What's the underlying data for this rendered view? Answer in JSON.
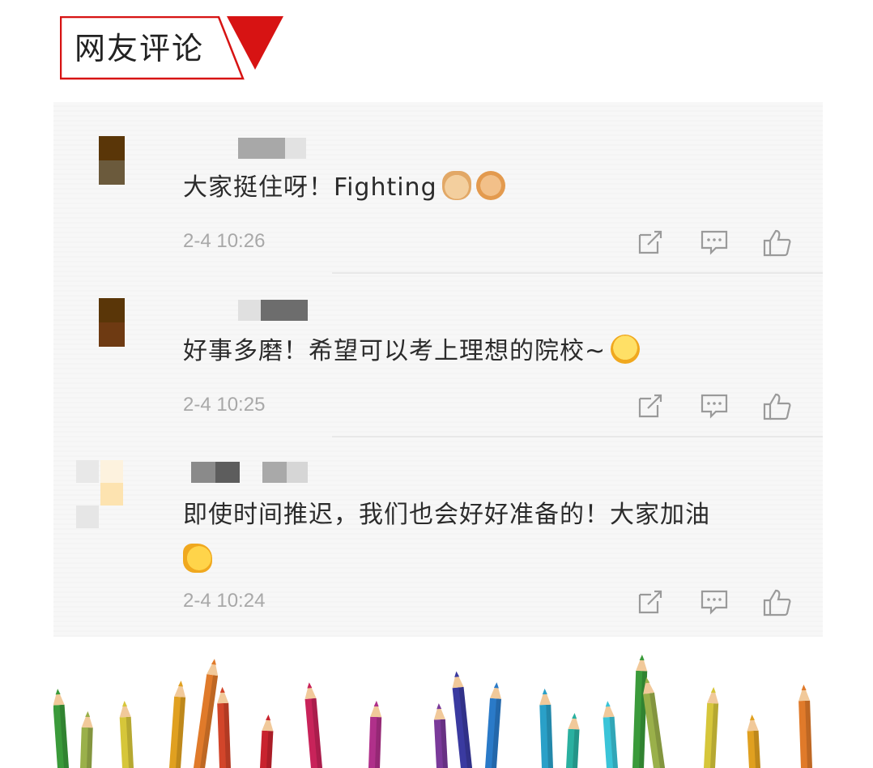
{
  "header": {
    "title": "网友评论"
  },
  "colors": {
    "accent": "#d71313",
    "pencil_colors": [
      "#3a9a3a",
      "#9ab04a",
      "#d6c63a",
      "#e0a020",
      "#e07a2a",
      "#d2452a",
      "#c8232e",
      "#c8235a",
      "#b0308a",
      "#7a3a9a",
      "#3a3aa0",
      "#2a7ac8",
      "#2aa0c8",
      "#2ab0a0",
      "#3ac4d8"
    ]
  },
  "comments": [
    {
      "text": "大家挺住呀！Fighting",
      "emojis": [
        "folded-hands-emoji",
        "fist-emoji"
      ],
      "time": "2-4 10:26"
    },
    {
      "text": "好事多磨！希望可以考上理想的院校~",
      "emojis": [
        "excited-face-emoji"
      ],
      "time": "2-4 10:25"
    },
    {
      "text": "即使时间推迟，我们也会好好准备的！大家加油",
      "emojis": [
        "flexed-biceps-emoji"
      ],
      "time": "2-4 10:24"
    }
  ],
  "actions": {
    "icons": [
      "share-icon",
      "comment-icon",
      "like-icon"
    ]
  }
}
